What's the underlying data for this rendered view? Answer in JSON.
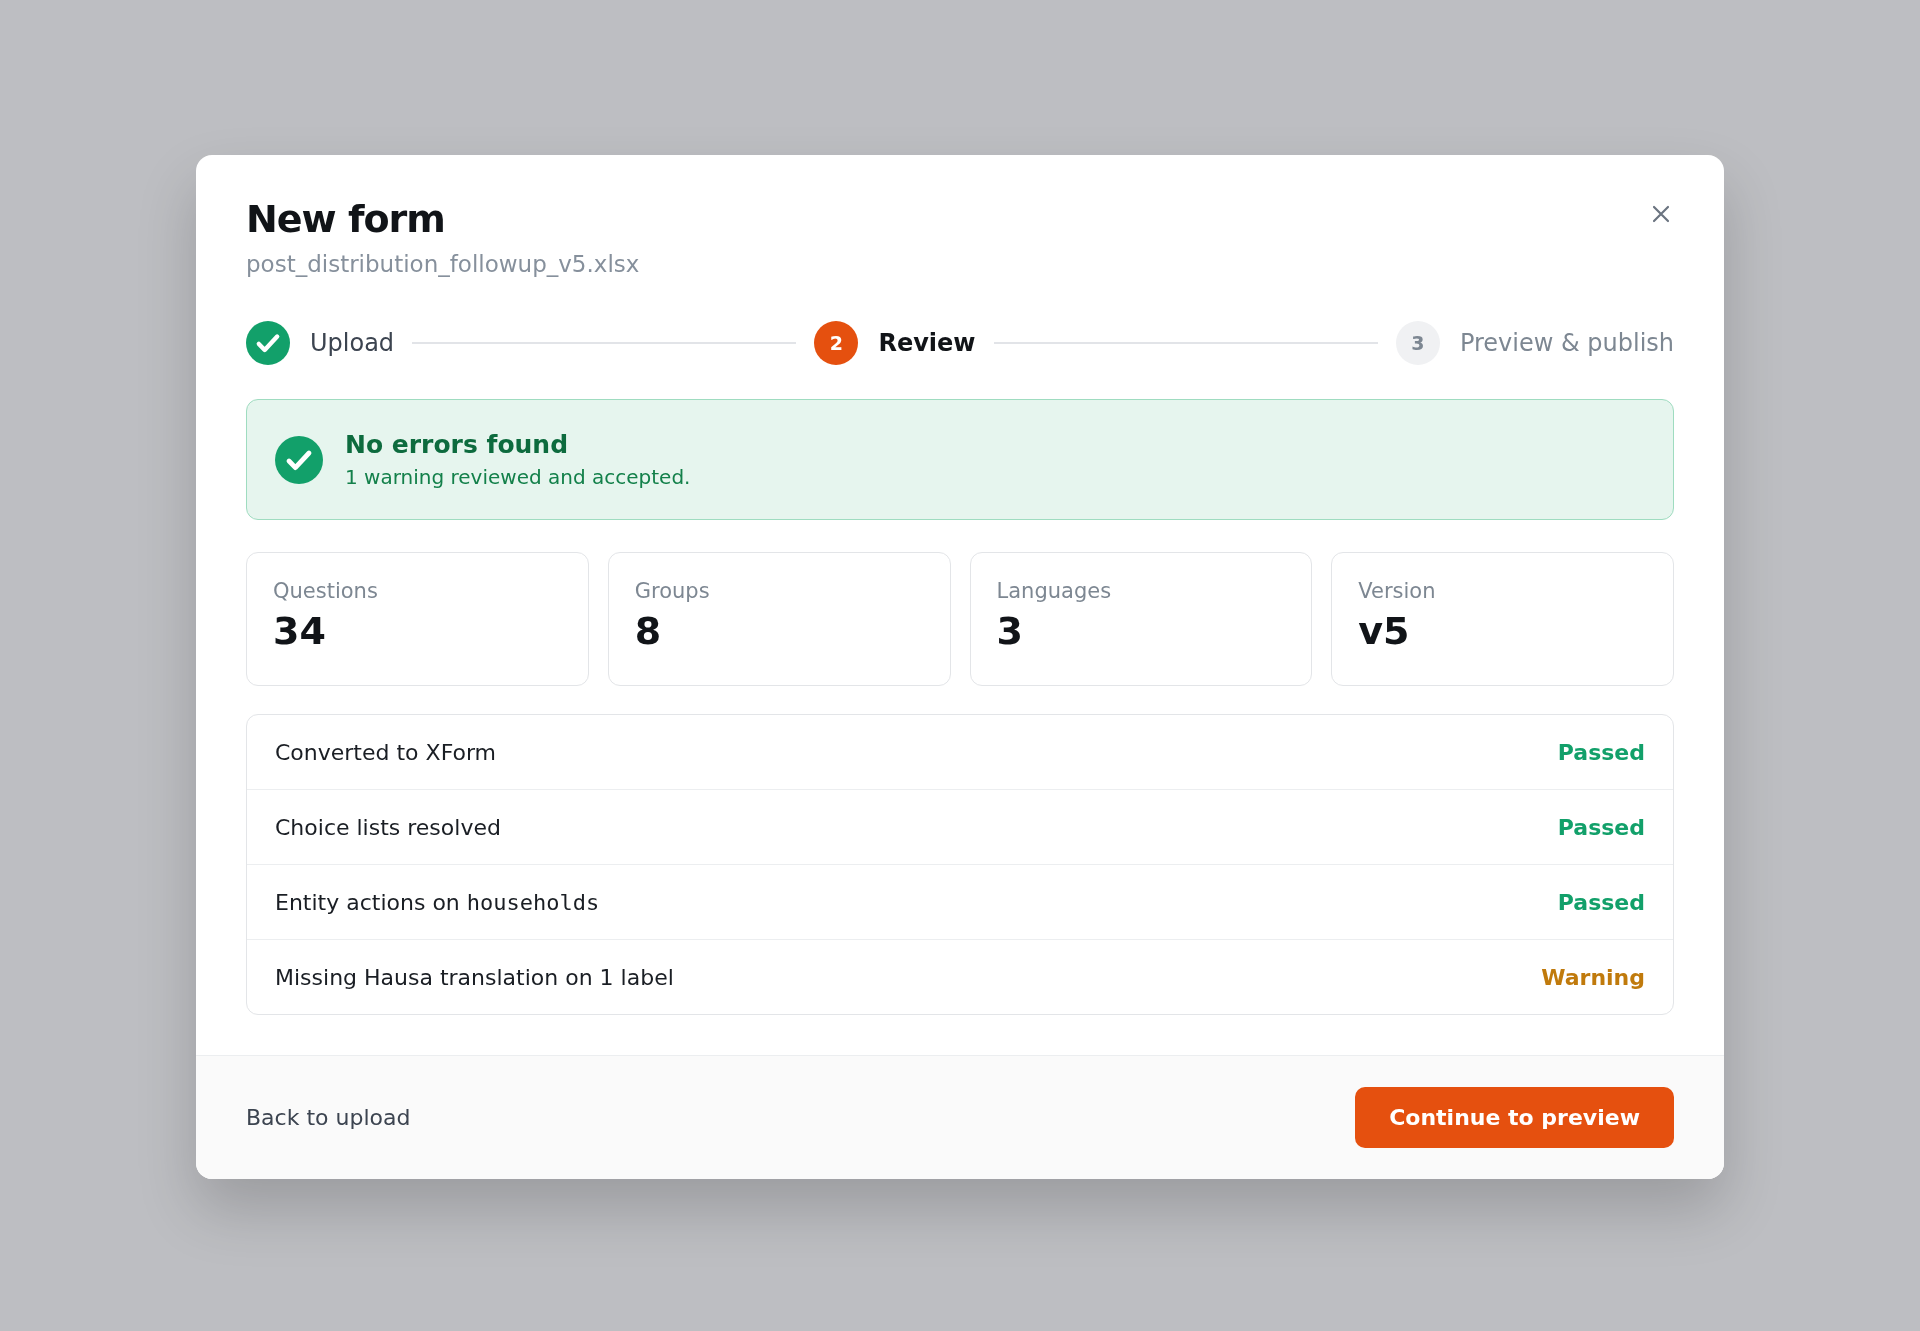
{
  "dialog": {
    "title": "New form",
    "filename": "post_distribution_followup_v5.xlsx"
  },
  "steps": [
    {
      "label": "Upload",
      "done": true,
      "selected": false
    },
    {
      "number": "2",
      "label": "Review",
      "done": false,
      "selected": true
    },
    {
      "number": "3",
      "label": "Preview & publish",
      "done": false,
      "selected": false
    }
  ],
  "banner": {
    "kind": "success",
    "title": "No errors found",
    "message": "1 warning reviewed and accepted."
  },
  "stats": [
    {
      "label": "Questions",
      "value": "34"
    },
    {
      "label": "Groups",
      "value": "8"
    },
    {
      "label": "Languages",
      "value": "3"
    },
    {
      "label": "Version",
      "value": "v5"
    }
  ],
  "checks": [
    {
      "label": "Converted to XForm",
      "status": "Passed",
      "kind": "passed"
    },
    {
      "label": "Choice lists resolved",
      "status": "Passed",
      "kind": "passed"
    },
    {
      "label": "Entity actions on",
      "code": "households",
      "status": "Passed",
      "kind": "passed"
    },
    {
      "label": "Missing Hausa translation on 1 label",
      "status": "Warning",
      "kind": "warning"
    }
  ],
  "footer": {
    "back": "Back to upload",
    "primary": "Continue to preview"
  }
}
